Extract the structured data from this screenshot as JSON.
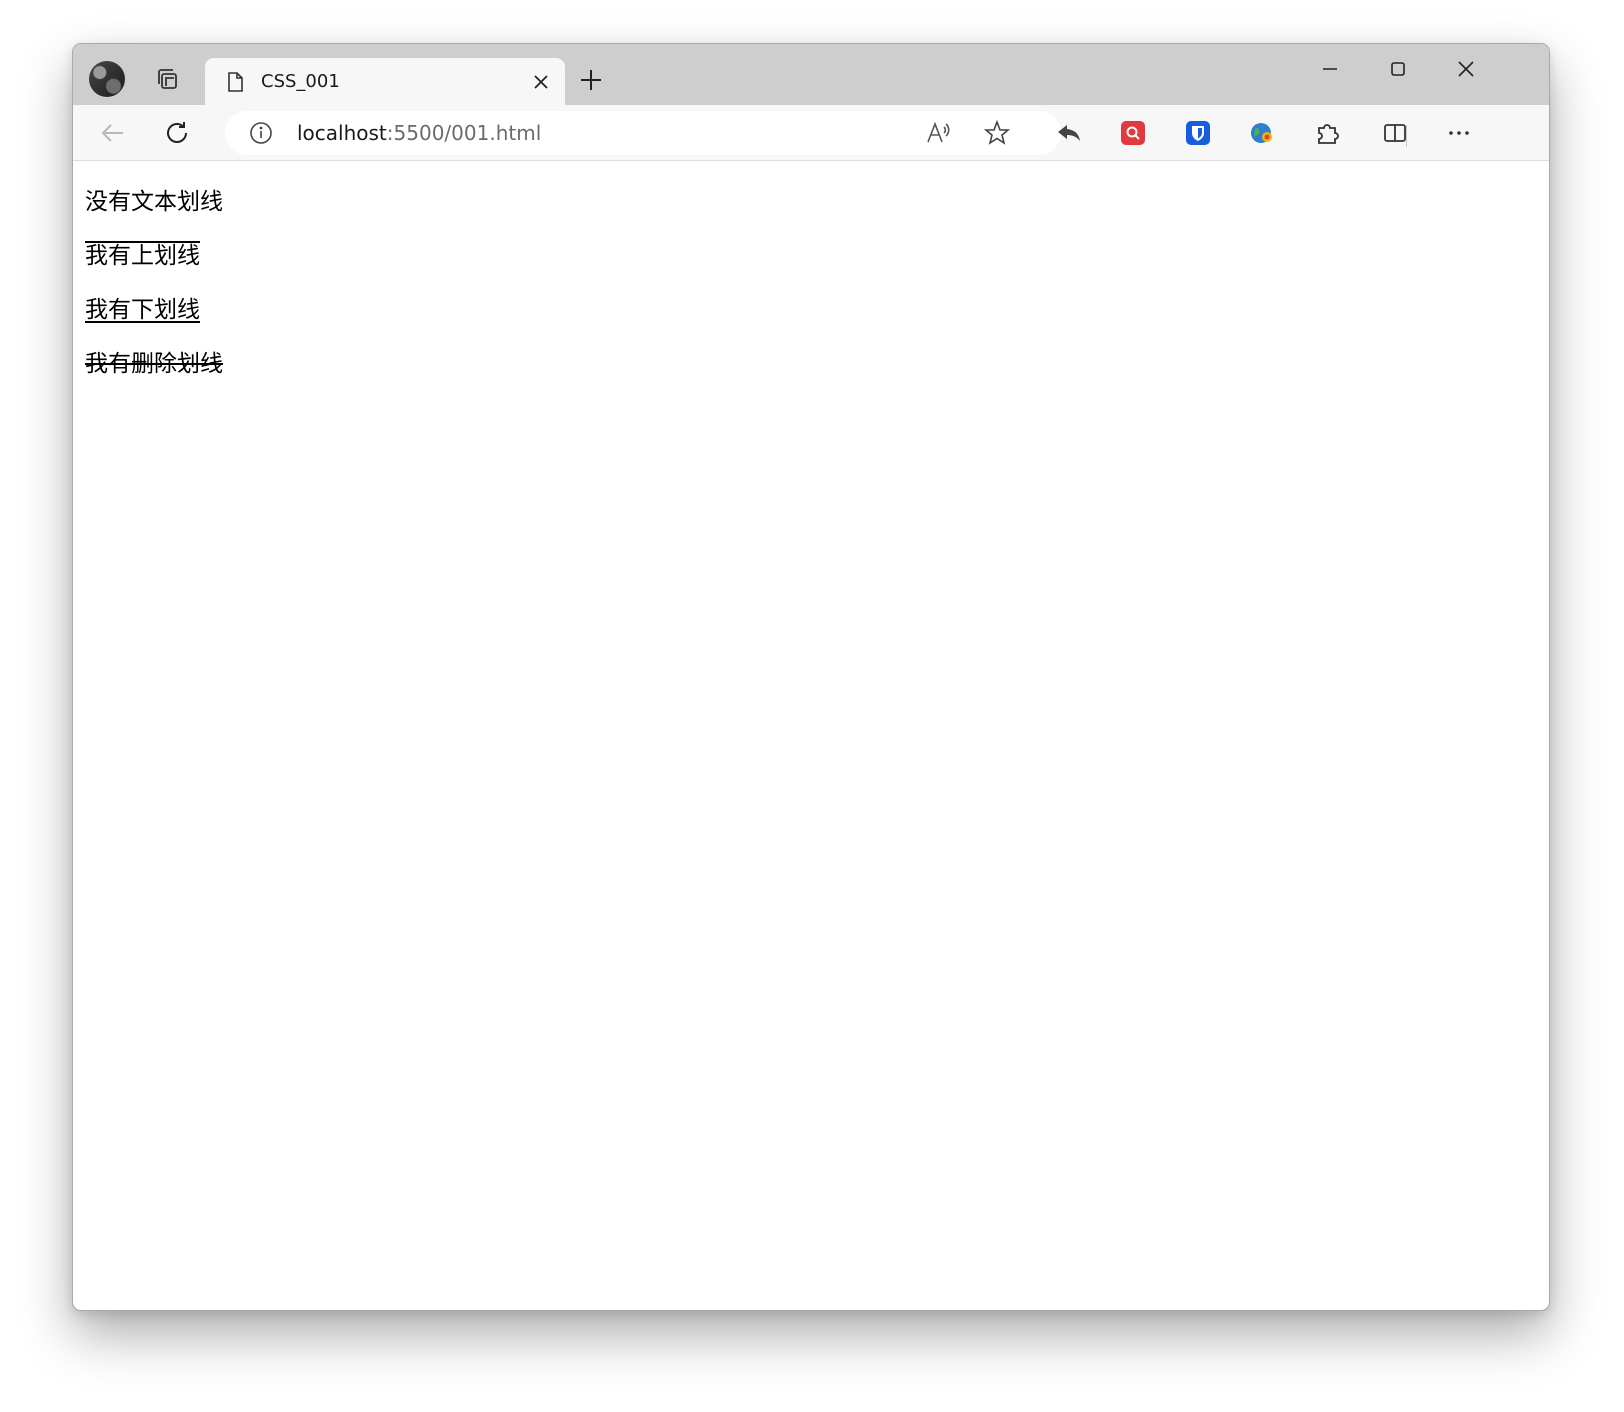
{
  "browser": {
    "tab": {
      "title": "CSS_001"
    },
    "address_bar": {
      "host": "localhost",
      "rest": ":5500/001.html"
    },
    "icons": {
      "profile": "avatar",
      "tab_actions": "workspaces-icon",
      "tab_favicon": "page-icon",
      "tab_close": "close-icon",
      "new_tab": "plus-icon",
      "minimize": "minimize-icon",
      "maximize": "maximize-icon",
      "close_window": "close-icon",
      "back": "back-arrow-icon",
      "refresh": "refresh-icon",
      "site_info": "info-icon",
      "read_aloud": "read-aloud-icon",
      "favorite": "star-icon",
      "share_back": "reply-arrow-icon",
      "extension_1": "search-extension-icon",
      "extension_2": "bitwarden-shield-icon",
      "extension_3": "globe-extension-icon",
      "extensions": "puzzle-icon",
      "split_screen": "split-screen-icon",
      "more": "more-icon"
    },
    "colors": {
      "tabstrip": "#cecece",
      "toolbar": "#f7f7f7",
      "extension_red": "#e0393e",
      "extension_blue": "#175ddc"
    }
  },
  "page": {
    "lines": [
      {
        "text": "没有文本划线",
        "decoration": "none"
      },
      {
        "text": "我有上划线",
        "decoration": "overline"
      },
      {
        "text": "我有下划线",
        "decoration": "underline"
      },
      {
        "text": "我有删除划线",
        "decoration": "line-through"
      }
    ]
  }
}
